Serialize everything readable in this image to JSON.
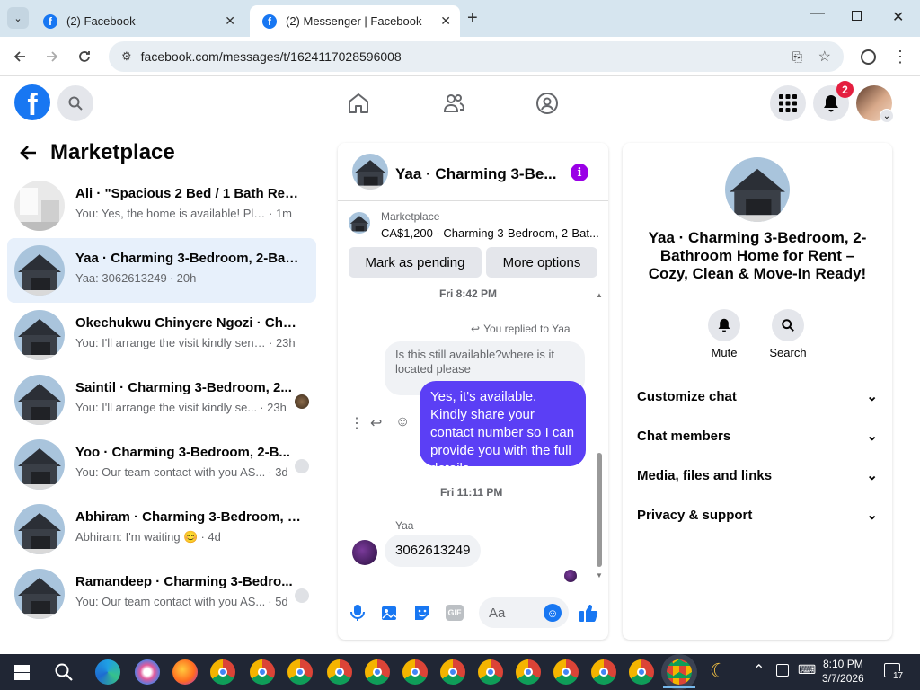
{
  "browser": {
    "tabs": [
      {
        "title": "(2) Facebook",
        "active": false
      },
      {
        "title": "(2) Messenger | Facebook",
        "active": true
      }
    ],
    "url": "facebook.com/messages/t/1624117028596008"
  },
  "fb_header": {
    "notification_count": "2"
  },
  "left_panel": {
    "title": "Marketplace",
    "conversations": [
      {
        "name": "Ali · \"Spacious 2 Bed / 1 Bath Rent...",
        "preview": "You: Yes, the home is available! Pleas...",
        "time": "· 1m"
      },
      {
        "name": "Yaa · Charming 3-Bedroom, 2-Bath...",
        "preview": "Yaa: 3062613249",
        "time": "· 20h"
      },
      {
        "name": "Okechukwu Chinyere Ngozi · Char...",
        "preview": "You: I'll arrange the visit kindly send ...",
        "time": "· 23h"
      },
      {
        "name": "Saintil · Charming 3-Bedroom, 2...",
        "preview": "You: I'll arrange the visit kindly se...",
        "time": "· 23h"
      },
      {
        "name": "Yoo · Charming 3-Bedroom, 2-B...",
        "preview": "You: Our team contact with you AS...",
        "time": "· 3d"
      },
      {
        "name": "Abhiram · Charming 3-Bedroom, 2...",
        "preview": "Abhiram: I'm waiting 😊",
        "time": "· 4d"
      },
      {
        "name": "Ramandeep · Charming 3-Bedro...",
        "preview": "You: Our team contact with you AS...",
        "time": "· 5d"
      }
    ]
  },
  "chat": {
    "header_title": "Yaa · Charming 3-Be...",
    "listing_label": "Marketplace",
    "listing_text": "CA$1,200 - Charming 3-Bedroom, 2-Bat...",
    "mark_pending": "Mark as pending",
    "more_options": "More options",
    "ts1": "Fri 8:42 PM",
    "replied": "You replied to Yaa",
    "quoted": "Is this still available?where is it located please",
    "my_message": "Yes, it's available. Kindly share your contact number so I can provide you with the full details.",
    "ts2": "Fri 11:11 PM",
    "sender": "Yaa",
    "their_message": "3062613249",
    "input_placeholder": "Aa"
  },
  "right_panel": {
    "title": "Yaa · Charming 3-Bedroom, 2-Bathroom Home for Rent – Cozy, Clean & Move-In Ready!",
    "mute": "Mute",
    "search": "Search",
    "sections": [
      "Customize chat",
      "Chat members",
      "Media, files and links",
      "Privacy & support"
    ]
  },
  "taskbar": {
    "time": "8:10 PM",
    "date": "3/7/2026",
    "notif": "17"
  },
  "colors": {
    "fb_blue": "#1877f2",
    "message_purple": "#5b3ff5",
    "active_row": "#e7f0fb"
  }
}
